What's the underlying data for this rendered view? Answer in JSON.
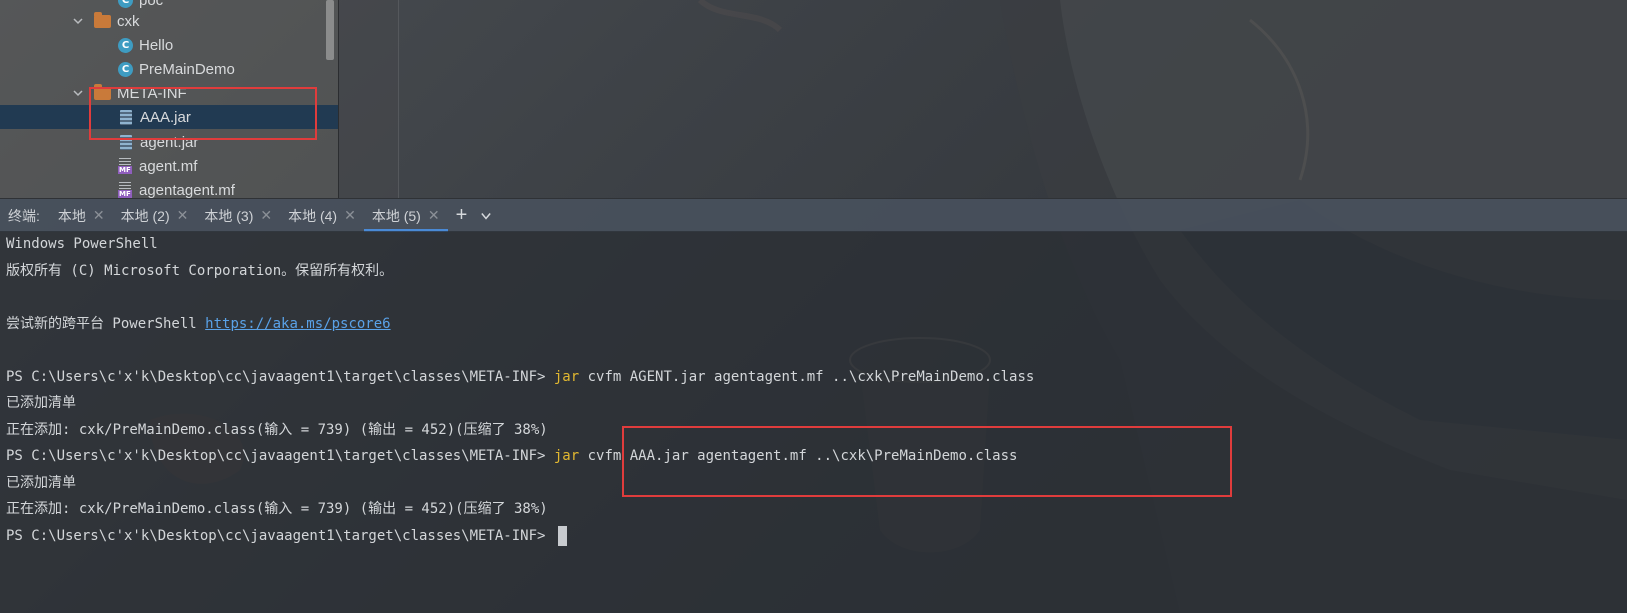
{
  "project_tree": {
    "items": [
      {
        "label": "poc",
        "type": "class"
      },
      {
        "label": "cxk",
        "type": "folder"
      },
      {
        "label": "Hello",
        "type": "class"
      },
      {
        "label": "PreMainDemo",
        "type": "class"
      },
      {
        "label": "META-INF",
        "type": "folder"
      },
      {
        "label": "AAA.jar",
        "type": "jar",
        "selected": true
      },
      {
        "label": "agent.jar",
        "type": "jar"
      },
      {
        "label": "agent.mf",
        "type": "mf"
      },
      {
        "label": "agentagent.mf",
        "type": "mf"
      }
    ]
  },
  "terminal_tabs": {
    "label": "终端:",
    "tabs": [
      {
        "label": "本地"
      },
      {
        "label": "本地 (2)"
      },
      {
        "label": "本地 (3)"
      },
      {
        "label": "本地 (4)"
      },
      {
        "label": "本地 (5)",
        "active": true
      }
    ],
    "add_label": "+"
  },
  "terminal": {
    "lines": [
      {
        "text": "Windows PowerShell"
      },
      {
        "text": "版权所有 (C) Microsoft Corporation。保留所有权利。"
      },
      {
        "text": ""
      },
      {
        "prefix": "尝试新的跨平台 PowerShell ",
        "link": "https://aka.ms/pscore6"
      },
      {
        "text": ""
      },
      {
        "prompt": "PS C:\\Users\\c'x'k\\Desktop\\cc\\javaagent1\\target\\classes\\META-INF> ",
        "cmd_kw": "jar",
        "cmd_rest": " cvfm AGENT.jar agentagent.mf ..\\cxk\\PreMainDemo.class"
      },
      {
        "text": "已添加清单"
      },
      {
        "text": "正在添加: cxk/PreMainDemo.class(输入 = 739) (输出 = 452)(压缩了 38%)"
      },
      {
        "prompt": "PS C:\\Users\\c'x'k\\Desktop\\cc\\javaagent1\\target\\classes\\META-INF> ",
        "cmd_kw": "jar",
        "cmd_rest": " cvfm AAA.jar agentagent.mf ..\\cxk\\PreMainDemo.class"
      },
      {
        "text": "已添加清单"
      },
      {
        "text": "正在添加: cxk/PreMainDemo.class(输入 = 739) (输出 = 452)(压缩了 38%)"
      },
      {
        "prompt": "PS C:\\Users\\c'x'k\\Desktop\\cc\\javaagent1\\target\\classes\\META-INF> ",
        "cursor": true
      }
    ]
  },
  "colors": {
    "highlight_box": "#e03c3c",
    "keyword": "#e2b830",
    "link": "#5aa2e8",
    "active_tab_underline": "#4a8ad6"
  }
}
